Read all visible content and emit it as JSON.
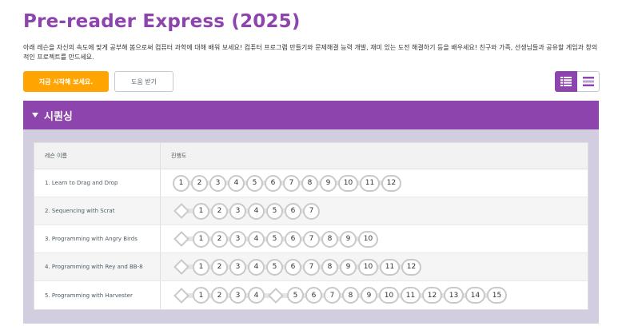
{
  "page": {
    "title": "Pre-reader Express (2025)",
    "description": "아래 레슨을 자신의 속도에 맞게 공부해 봄으로써 컴퓨터 과학에 대해 배워 보세요! 컴퓨터 프로그램 만들기와 문제해결 능력 개발, 재미 있는 도전 해결하기 등을 배우세요! 친구와 가족, 선생님들과 공유할 게임과 창의적인 프로젝트를 만드세요."
  },
  "buttons": {
    "start_label": "지금 시작해 보세요.",
    "help_label": "도움 받기"
  },
  "view_toggle": {
    "detail_icon": "list-detail-icon",
    "summary_icon": "list-summary-icon"
  },
  "section": {
    "title": "시퀀싱",
    "toggle_icon": "caret-down-icon",
    "headers": {
      "name": "레슨 이름",
      "progress": "진행도"
    },
    "lessons": [
      {
        "name": "1. Learn to Drag and Drop",
        "items": [
          "1",
          "2",
          "3",
          "4",
          "5",
          "6",
          "7",
          "8",
          "9",
          "10",
          "11",
          "12"
        ],
        "start_type": "circle"
      },
      {
        "name": "2. Sequencing with Scrat",
        "items": [
          "1",
          "2",
          "3",
          "4",
          "5",
          "6",
          "7"
        ],
        "start_type": "diamond"
      },
      {
        "name": "3. Programming with Angry Birds",
        "items": [
          "1",
          "2",
          "3",
          "4",
          "5",
          "6",
          "7",
          "8",
          "9",
          "10"
        ],
        "start_type": "diamond"
      },
      {
        "name": "4. Programming with Rey and BB-8",
        "items": [
          "1",
          "2",
          "3",
          "4",
          "5",
          "6",
          "7",
          "8",
          "9",
          "10",
          "11",
          "12"
        ],
        "start_type": "diamond"
      },
      {
        "name": "5. Programming with Harvester",
        "items": [
          "1",
          "2",
          "3",
          "4",
          "5",
          "6",
          "7",
          "8",
          "9",
          "10",
          "11",
          "12",
          "13",
          "14",
          "15"
        ],
        "start_type": "diamond",
        "extra_diamond_after": "4"
      }
    ]
  },
  "colors": {
    "brand_purple": "#8e44ad",
    "accent_orange": "#ffa400",
    "section_bg": "#d3cde0"
  }
}
